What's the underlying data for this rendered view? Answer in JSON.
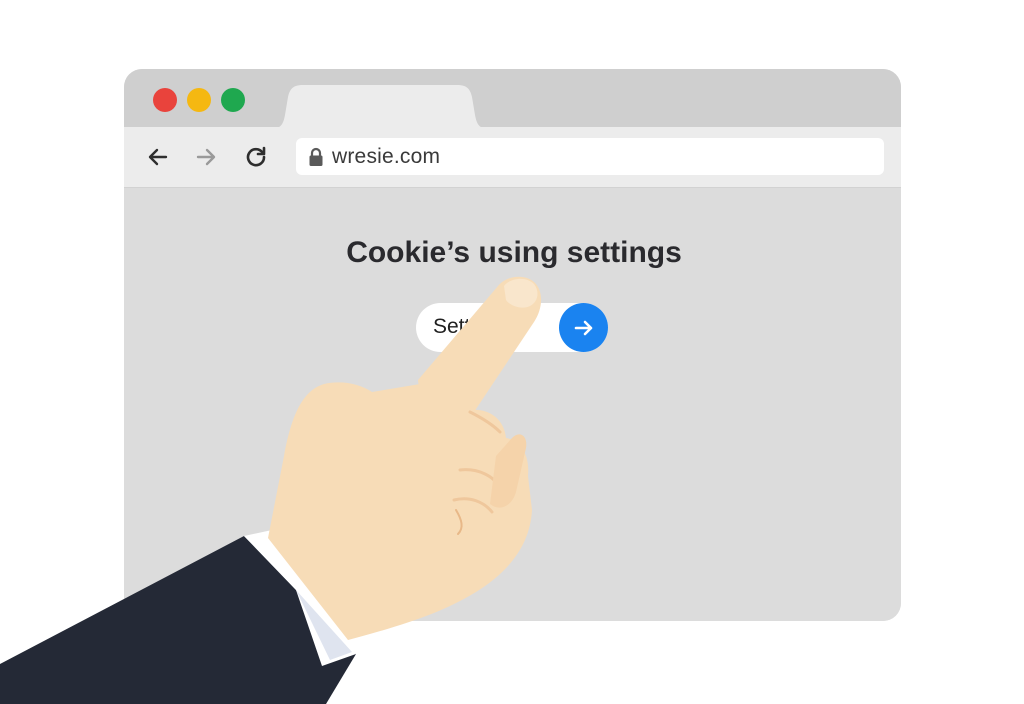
{
  "browser": {
    "controls": {
      "close_color": "#e9433c",
      "minimize_color": "#f5b811",
      "maximize_color": "#1fa84f"
    },
    "toolbar": {
      "back_icon": "arrow-left-icon",
      "forward_icon": "arrow-right-icon",
      "reload_icon": "reload-icon",
      "url_icon": "lock-icon",
      "url": "wresie.com"
    }
  },
  "page": {
    "heading": "Cookie’s using settings",
    "setting_button": {
      "label": "Sett me",
      "go_icon": "arrow-right-icon",
      "accent_color": "#1a83f0"
    }
  },
  "overlay": {
    "subject": "pointing-hand"
  }
}
